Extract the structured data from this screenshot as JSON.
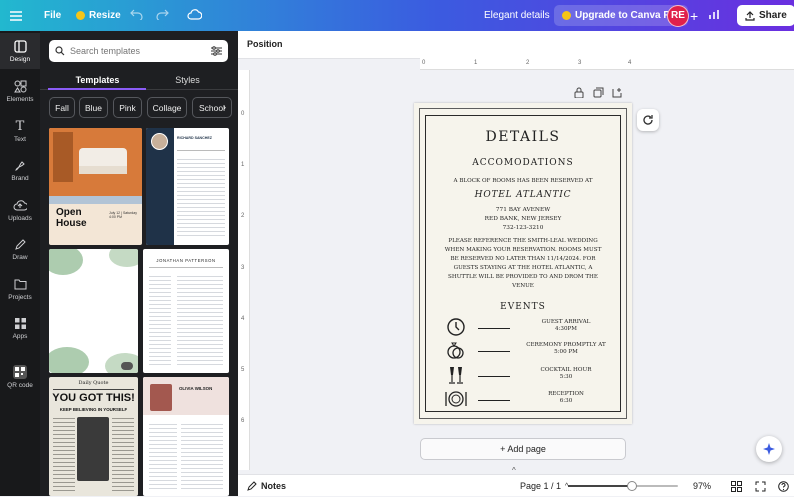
{
  "topbar": {
    "file_label": "File",
    "resize_label": "Resize",
    "doc_title": "Elegant details",
    "upgrade_label": "Upgrade to Canva Pro",
    "avatar_initials": "RE",
    "share_label": "Share",
    "resize_icon_color": "#f5c518",
    "avatar_color": "#e0204a"
  },
  "rail": {
    "items": [
      {
        "label": "Design",
        "icon": "design-icon"
      },
      {
        "label": "Elements",
        "icon": "elements-icon"
      },
      {
        "label": "Text",
        "icon": "text-icon"
      },
      {
        "label": "Brand",
        "icon": "brand-icon"
      },
      {
        "label": "Uploads",
        "icon": "uploads-icon"
      },
      {
        "label": "Draw",
        "icon": "draw-icon"
      },
      {
        "label": "Projects",
        "icon": "projects-icon"
      },
      {
        "label": "Apps",
        "icon": "apps-icon"
      },
      {
        "label": "QR code",
        "icon": "qr-code-icon"
      }
    ]
  },
  "panel": {
    "search_placeholder": "Search templates",
    "tabs": [
      "Templates",
      "Styles"
    ],
    "chips": [
      "Fall",
      "Blue",
      "Pink",
      "Collage",
      "School"
    ],
    "thumbs": {
      "open_house_title": "Open",
      "open_house_title2": "House",
      "open_house_date": "July 12 | Saturday 4:00 PM",
      "resume1_name": "RICHARD SANCHEZ",
      "resume2_name": "JONATHAN PATTERSON",
      "newspaper_header": "Daily Quote",
      "newspaper_title": "YOU GOT THIS!",
      "newspaper_sub": "KEEP BELIEVING IN YOURSELF",
      "resume3_name": "OLIVIA WILSON"
    }
  },
  "context_bar": {
    "position_label": "Position"
  },
  "rulers": {
    "h_ticks": [
      "0",
      "1",
      "2",
      "3",
      "4"
    ],
    "v_ticks": [
      "0",
      "1",
      "2",
      "3",
      "4",
      "5",
      "6"
    ]
  },
  "page": {
    "title": "DETAILS",
    "accom_heading": "ACCOMODATIONS",
    "block_line": "A BLOCK OF ROOMS HAS BEEN RESERVED AT",
    "hotel": "HOTEL ATLANTIC",
    "address1": "771 BAY AVENEW",
    "address2": "RED BANK, NEW JERSEY",
    "phone": "732-123-3210",
    "para1": "PLEASE REFERENCE THE SMITH-LEAL WEDDING",
    "para2": "WHEN MAKING YOUR RESERVATION. ROOMS MUST",
    "para3": "BE RESERVED NO LATER THAN 11/14/2024. FOR",
    "para4": "GUESTS STAYING AT THE HOTEL ATLANTIC, A",
    "para5": "SHUTTLE WILL BE PROVIDED TO AND DROM THE",
    "para6": "VENUE",
    "events_heading": "EVENTS",
    "events": [
      {
        "name": "GUEST ARRIVAL",
        "time": "4:30PM",
        "icon": "clock-icon"
      },
      {
        "name": "CEREMONY PROMPTLY AT",
        "time": "5:00 PM",
        "icon": "rings-icon"
      },
      {
        "name": "COCKTAIL HOUR",
        "time": "5:30",
        "icon": "champagne-icon"
      },
      {
        "name": "RECEPTION",
        "time": "6:30",
        "icon": "dinner-plate-icon"
      }
    ]
  },
  "add_page_label": "+ Add page",
  "bottombar": {
    "notes_label": "Notes",
    "page_indicator": "Page 1 / 1",
    "zoom": "97%",
    "zoom_fraction": 0.58
  }
}
